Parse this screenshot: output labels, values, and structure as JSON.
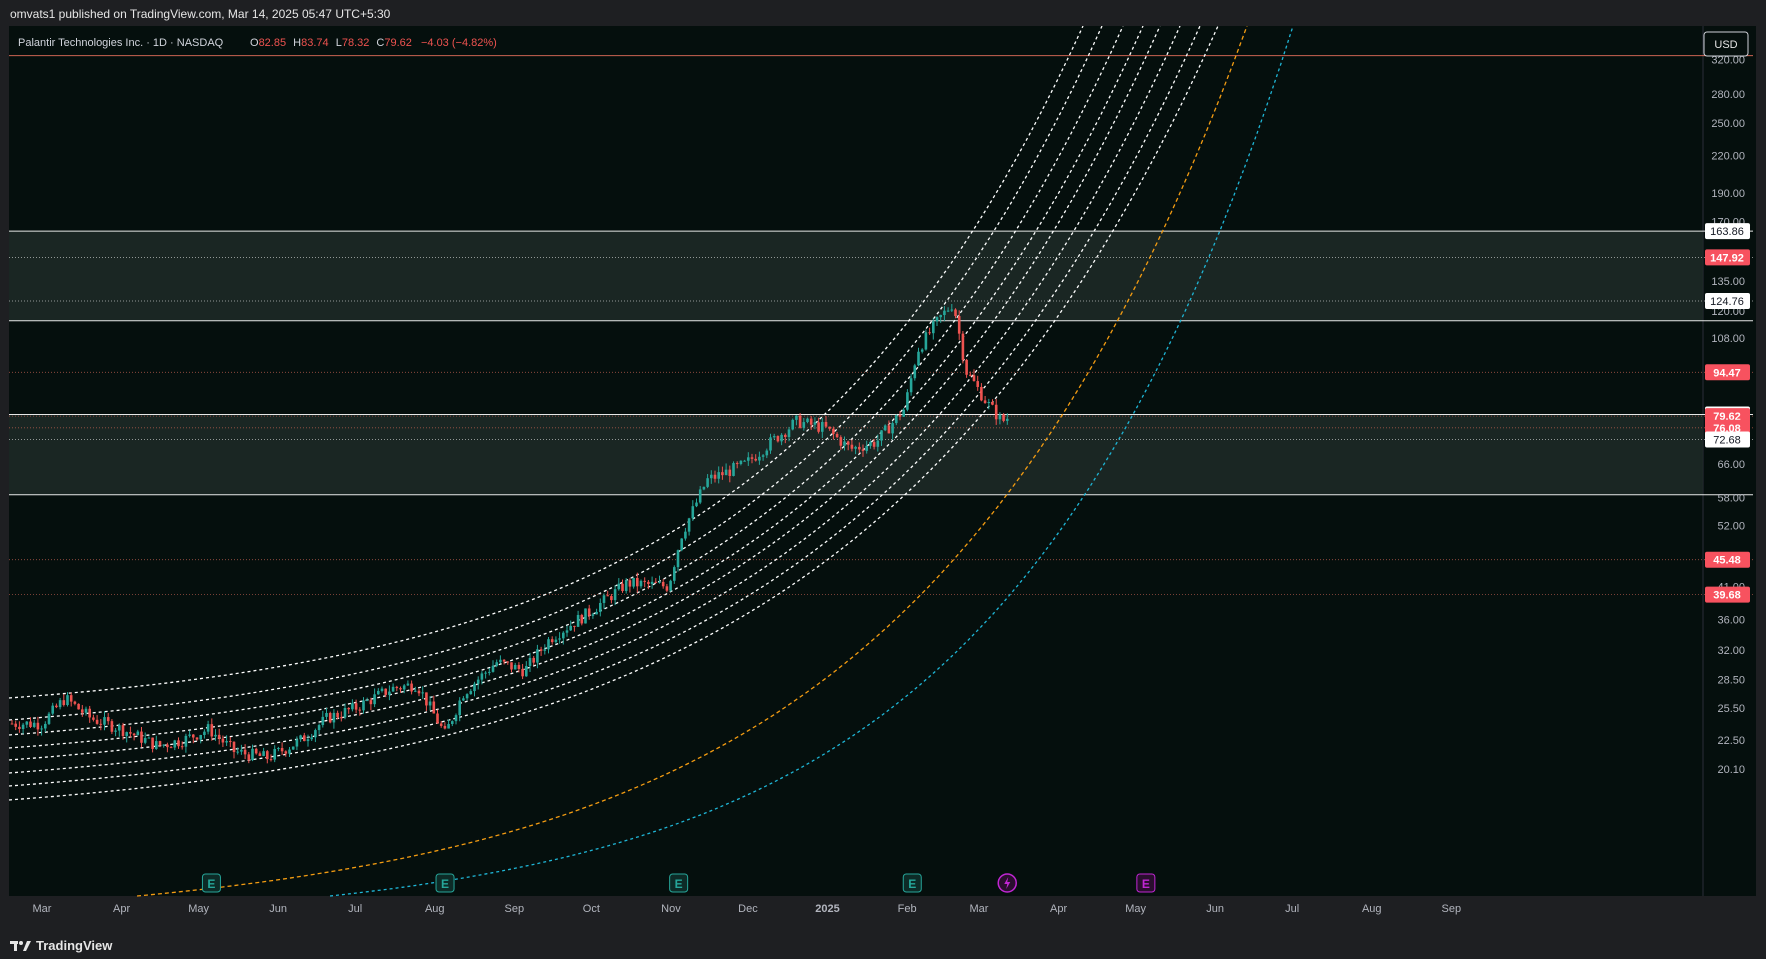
{
  "header": {
    "publisher": "omvats1 published on TradingView.com, Mar 14, 2025 05:47 UTC+5:30"
  },
  "legend": {
    "symbol": "Palantir Technologies Inc. · 1D · NASDAQ",
    "open_label": "O",
    "open_value": "82.85",
    "high_label": "H",
    "high_value": "83.74",
    "low_label": "L",
    "low_value": "78.32",
    "close_label": "C",
    "close_value": "79.62",
    "change": "−4.03 (−4.82%)"
  },
  "currency_button": "USD",
  "footer": {
    "brand": "TradingView"
  },
  "colors": {
    "background": "#050f0d",
    "up": "#26a69a",
    "down": "#ef5350",
    "zone": "#1f2a28",
    "orange_curve": "#f39c12",
    "cyan_curve": "#1fb6d6",
    "white_curve": "#ffffff",
    "red_line": "#e06c5a"
  },
  "chart_data": {
    "type": "candlestick",
    "symbol": "PLTR",
    "interval": "1D",
    "scale": "log",
    "y_ticks": [
      20.1,
      22.5,
      25.5,
      28.5,
      32.0,
      36.0,
      41.0,
      52.0,
      58.0,
      66.0,
      108.0,
      120.0,
      135.0,
      170.0,
      190.0,
      220.0,
      250.0,
      280.0,
      320.0
    ],
    "x_ticks": [
      "Mar",
      "Apr",
      "May",
      "Jun",
      "Jul",
      "Aug",
      "Sep",
      "Oct",
      "Nov",
      "Dec",
      "2025",
      "Feb",
      "Mar",
      "Apr",
      "May",
      "Jun",
      "Jul",
      "Aug",
      "Sep"
    ],
    "price_labels": [
      {
        "value": "163.86",
        "style": "white"
      },
      {
        "value": "147.92",
        "style": "red"
      },
      {
        "value": "124.76",
        "style": "white"
      },
      {
        "value": "94.47",
        "style": "red"
      },
      {
        "value": "80.14",
        "style": "white"
      },
      {
        "value": "79.62",
        "style": "red"
      },
      {
        "value": "76.08",
        "style": "red"
      },
      {
        "value": "72.68",
        "style": "white"
      },
      {
        "value": "45.48",
        "style": "red"
      },
      {
        "value": "39.68",
        "style": "red"
      }
    ],
    "horizontal_levels": [
      {
        "price": 325,
        "style": "solid-red"
      },
      {
        "price": 163.86,
        "style": "solid-white"
      },
      {
        "price": 147.92,
        "style": "dotted-white"
      },
      {
        "price": 124.76,
        "style": "dotted-white"
      },
      {
        "price": 115.5,
        "style": "solid-white"
      },
      {
        "price": 94.47,
        "style": "dotted-red"
      },
      {
        "price": 80.14,
        "style": "solid-white"
      },
      {
        "price": 79.62,
        "style": "dotted-red"
      },
      {
        "price": 76.08,
        "style": "dotted-red"
      },
      {
        "price": 72.68,
        "style": "dotted-white"
      },
      {
        "price": 58.6,
        "style": "solid-white"
      },
      {
        "price": 45.48,
        "style": "dotted-red"
      },
      {
        "price": 39.68,
        "style": "dotted-red"
      }
    ],
    "zones": [
      {
        "from": 115.5,
        "to": 163.86
      },
      {
        "from": 58.6,
        "to": 80.14
      }
    ],
    "earnings_markers": [
      "May",
      "Aug",
      "Nov",
      "Feb",
      "May"
    ],
    "price_path": [
      {
        "date": "2024-03-01",
        "close": 24.0
      },
      {
        "date": "2024-03-10",
        "close": 26.5
      },
      {
        "date": "2024-03-20",
        "close": 24.5
      },
      {
        "date": "2024-04-01",
        "close": 23.5
      },
      {
        "date": "2024-04-15",
        "close": 22.0
      },
      {
        "date": "2024-04-25",
        "close": 22.5
      },
      {
        "date": "2024-05-05",
        "close": 23.5
      },
      {
        "date": "2024-05-15",
        "close": 21.5
      },
      {
        "date": "2024-05-28",
        "close": 21.0
      },
      {
        "date": "2024-06-10",
        "close": 22.5
      },
      {
        "date": "2024-06-20",
        "close": 24.5
      },
      {
        "date": "2024-07-01",
        "close": 25.5
      },
      {
        "date": "2024-07-15",
        "close": 27.5
      },
      {
        "date": "2024-07-25",
        "close": 28.0
      },
      {
        "date": "2024-08-05",
        "close": 23.0
      },
      {
        "date": "2024-08-12",
        "close": 27.0
      },
      {
        "date": "2024-08-25",
        "close": 30.5
      },
      {
        "date": "2024-09-05",
        "close": 29.5
      },
      {
        "date": "2024-09-15",
        "close": 33.5
      },
      {
        "date": "2024-09-30",
        "close": 37.0
      },
      {
        "date": "2024-10-15",
        "close": 41.5
      },
      {
        "date": "2024-10-31",
        "close": 41.0
      },
      {
        "date": "2024-11-05",
        "close": 50.0
      },
      {
        "date": "2024-11-15",
        "close": 62.0
      },
      {
        "date": "2024-11-30",
        "close": 66.0
      },
      {
        "date": "2024-12-10",
        "close": 72.0
      },
      {
        "date": "2024-12-20",
        "close": 78.0
      },
      {
        "date": "2024-12-31",
        "close": 76.0
      },
      {
        "date": "2025-01-10",
        "close": 70.0
      },
      {
        "date": "2025-01-20",
        "close": 72.0
      },
      {
        "date": "2025-01-31",
        "close": 82.0
      },
      {
        "date": "2025-02-05",
        "close": 103.0
      },
      {
        "date": "2025-02-14",
        "close": 117.0
      },
      {
        "date": "2025-02-19",
        "close": 124.0
      },
      {
        "date": "2025-02-24",
        "close": 95.0
      },
      {
        "date": "2025-03-04",
        "close": 84.0
      },
      {
        "date": "2025-03-10",
        "close": 78.0
      },
      {
        "date": "2025-03-13",
        "close": 79.62
      }
    ],
    "curves": [
      {
        "style": "dotted-white",
        "count": 8
      },
      {
        "style": "dashed-orange",
        "count": 1
      },
      {
        "style": "dashed-cyan",
        "count": 1
      }
    ]
  }
}
